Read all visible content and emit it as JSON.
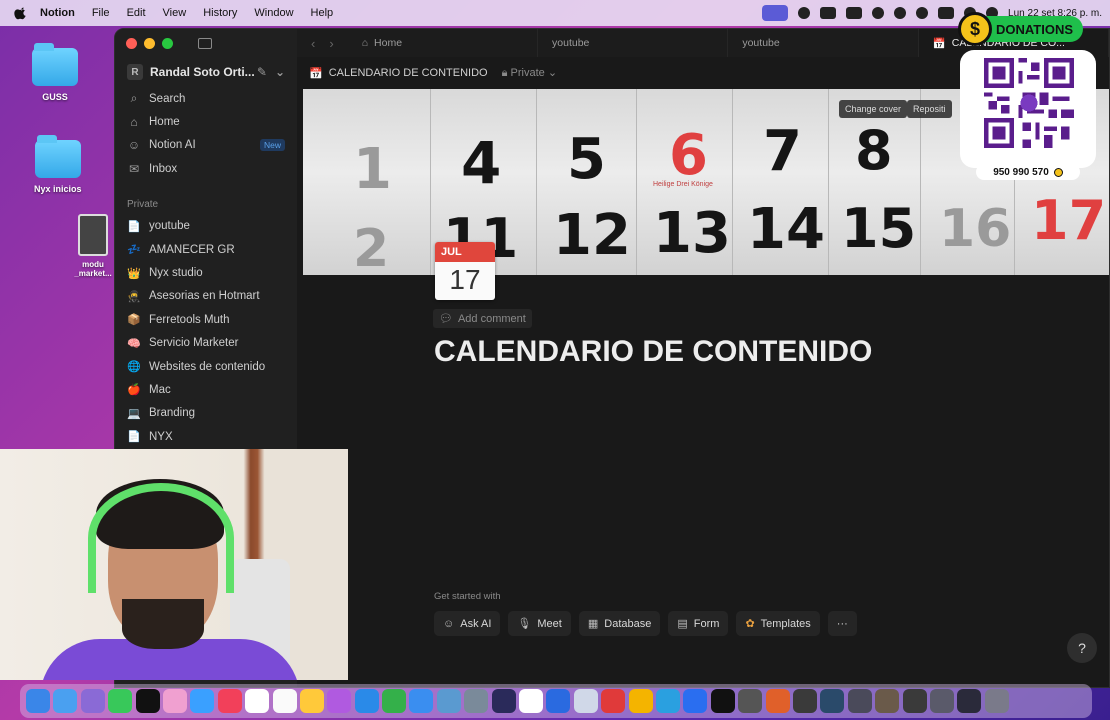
{
  "menubar": {
    "app_name": "Notion",
    "items": [
      "File",
      "Edit",
      "View",
      "History",
      "Window",
      "Help"
    ],
    "clock": "Lun 22 set  8:26 p. m."
  },
  "desktop": {
    "icons": [
      {
        "label": "GUSS"
      },
      {
        "label": "Nyx inicios"
      },
      {
        "label": "modu _market..."
      }
    ]
  },
  "sidebar": {
    "workspace_initial": "R",
    "workspace_name": "Randal Soto Orti...",
    "nav": [
      {
        "label": "Search",
        "icon": "search-icon"
      },
      {
        "label": "Home",
        "icon": "home-icon"
      },
      {
        "label": "Notion AI",
        "icon": "notion-ai-icon",
        "badge": "New"
      },
      {
        "label": "Inbox",
        "icon": "inbox-icon"
      }
    ],
    "section_label": "Private",
    "pages": [
      {
        "label": "youtube",
        "emoji": "📄"
      },
      {
        "label": "AMANECER GR",
        "emoji": "💤"
      },
      {
        "label": "Nyx studio",
        "emoji": "👑"
      },
      {
        "label": "Asesorias en Hotmart",
        "emoji": "🥷"
      },
      {
        "label": "Ferretools Muth",
        "emoji": "📦"
      },
      {
        "label": "Servicio Marketer",
        "emoji": "🧠"
      },
      {
        "label": "Websites de contenido",
        "emoji": "🌐"
      },
      {
        "label": "Mac",
        "emoji": "🍎"
      },
      {
        "label": "Branding",
        "emoji": "💻"
      },
      {
        "label": "NYX",
        "emoji": "📄"
      }
    ]
  },
  "tabs": [
    {
      "label": "Home",
      "icon": "home-icon"
    },
    {
      "label": "youtube"
    },
    {
      "label": "youtube"
    },
    {
      "label": "CALENDARIO DE CO...",
      "icon": "calendar-icon",
      "active": true
    }
  ],
  "topbar": {
    "page_title": "CALENDARIO DE CONTENIDO",
    "privacy": "Private"
  },
  "cover": {
    "change_cover": "Change cover",
    "reposition": "Repositi",
    "numbers": [
      "4",
      "5",
      "6",
      "7",
      "8",
      "11",
      "12",
      "13",
      "14",
      "15",
      "16",
      "17"
    ],
    "caption": "Heilige Drei Könige"
  },
  "page_icon": {
    "month": "JUL",
    "day": "17"
  },
  "add_comment": "Add comment",
  "page_title": "CALENDARIO DE CONTENIDO",
  "get_started": {
    "label": "Get started with",
    "actions": [
      {
        "label": "Ask AI",
        "icon": "ai-icon"
      },
      {
        "label": "Meet",
        "icon": "meet-icon"
      },
      {
        "label": "Database",
        "icon": "table-icon"
      },
      {
        "label": "Form",
        "icon": "form-icon"
      },
      {
        "label": "Templates",
        "icon": "templates-icon"
      }
    ],
    "more": "···"
  },
  "help_button": "?",
  "donations": {
    "title": "DONATIONS",
    "coin_symbol": "$",
    "phone": "950 990 570"
  },
  "colors": {
    "sidebar_bg": "#202020",
    "main_bg": "#191919",
    "accent_red": "#e0463c",
    "new_badge": "#5aa0e8",
    "donation_green": "#1fbf4b"
  }
}
